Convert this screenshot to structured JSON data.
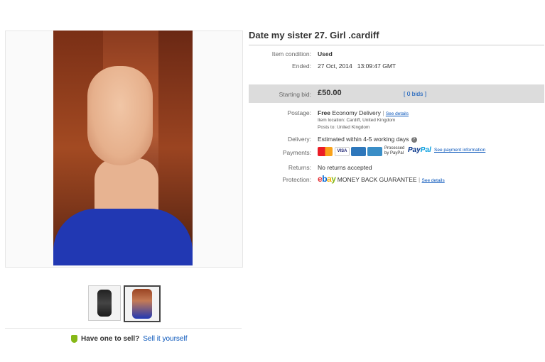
{
  "listing": {
    "title": "Date my sister 27. Girl .cardiff",
    "item_condition_label": "Item condition:",
    "item_condition_value": "Used",
    "ended_label": "Ended:",
    "ended_value": "27 Oct, 2014   13:09:47 GMT"
  },
  "bid": {
    "starting_bid_label": "Starting bid:",
    "price": "£50.00",
    "bids_link": "[ 0 bids ]"
  },
  "postage": {
    "label": "Postage:",
    "value_bold": "Free",
    "value_rest": "Economy Delivery",
    "separator": "|",
    "see_details": "See details",
    "item_location": "Item location:  Cardiff, United Kingdom",
    "posts_to": "Posts to:  United Kingdom"
  },
  "delivery": {
    "label": "Delivery:",
    "value": "Estimated within 4-5 working days",
    "info_icon": "?"
  },
  "payments": {
    "label": "Payments:",
    "visa": "VISA",
    "processed": "Processed",
    "by_paypal": "by PayPal",
    "paypal_pay": "Pay",
    "paypal_pal": "Pal",
    "see_payment": "See payment information",
    "icons": [
      "mastercard-icon",
      "visa-icon",
      "amex-icon",
      "discover-icon"
    ]
  },
  "returns": {
    "label": "Returns:",
    "value": "No returns accepted"
  },
  "protection": {
    "label": "Protection:",
    "ebay_e": "e",
    "ebay_b": "b",
    "ebay_a": "a",
    "ebay_y": "y",
    "money_back": "MONEY BACK GUARANTEE",
    "see_details": "See details"
  },
  "sell": {
    "question": "Have one to sell?",
    "link": "Sell it yourself"
  },
  "colors": {
    "link": "#0654ba",
    "bid_bar": "#dcdcdc",
    "ebay_red": "#e53238",
    "ebay_blue": "#0064d2",
    "ebay_yellow": "#f5af02",
    "ebay_green": "#86b817"
  }
}
